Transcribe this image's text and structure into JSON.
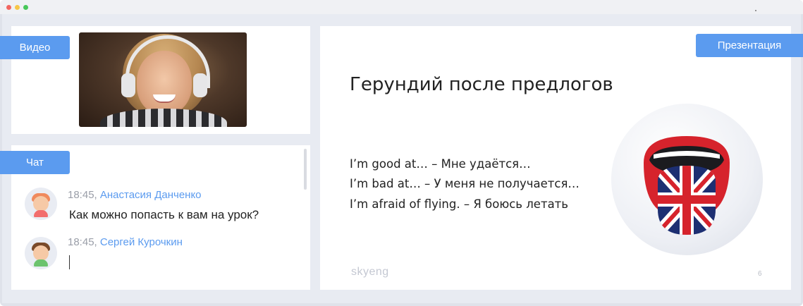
{
  "labels": {
    "video": "Видео",
    "chat": "Чат",
    "presentation": "Презентация"
  },
  "chat": {
    "messages": [
      {
        "time": "18:45, ",
        "author": "Анастасия Данченко",
        "text": "Как можно попасть к вам на урок?"
      },
      {
        "time": "18:45, ",
        "author": "Сергей Курочкин",
        "text": ""
      }
    ]
  },
  "slide": {
    "title": "Герундий после предлогов",
    "lines": [
      "I’m good at… – Мне удаётся…",
      "I’m bad at… – У меня не получается…",
      "I’m afraid of flying. – Я боюсь летать"
    ],
    "brand": "skyeng",
    "page_number": "6"
  },
  "colors": {
    "accent": "#5b9bef",
    "panel_bg": "#ffffff",
    "workspace_bg": "#e8ebf2"
  },
  "icons": [
    "window-close-icon",
    "window-minimize-icon",
    "window-maximize-icon",
    "tongue-flag-illustration"
  ]
}
